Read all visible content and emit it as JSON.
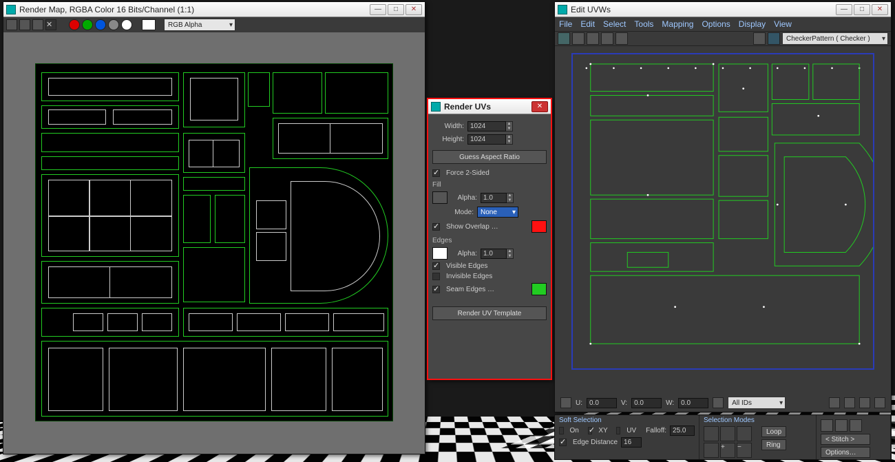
{
  "render_map": {
    "title": "Render Map, RGBA Color 16 Bits/Channel (1:1)",
    "channel_dropdown": "RGB Alpha"
  },
  "render_uvs": {
    "title": "Render UVs",
    "width_label": "Width:",
    "width_value": "1024",
    "height_label": "Height:",
    "height_value": "1024",
    "guess_btn": "Guess Aspect Ratio",
    "force2sided_label": "Force 2-Sided",
    "fill_label": "Fill",
    "alpha_label_fill": "Alpha:",
    "alpha_value_fill": "1.0",
    "mode_label": "Mode:",
    "mode_value": "None",
    "show_overlap_label": "Show Overlap …",
    "overlap_color": "#f11111",
    "edges_label": "Edges",
    "alpha_label_edges": "Alpha:",
    "alpha_value_edges": "1.0",
    "visible_edges": "Visible Edges",
    "invisible_edges": "Invisible Edges",
    "seam_edges": "Seam Edges …",
    "seam_color": "#22cc22",
    "render_btn": "Render UV Template"
  },
  "edit_uvws": {
    "title": "Edit UVWs",
    "menu": [
      "File",
      "Edit",
      "Select",
      "Tools",
      "Mapping",
      "Options",
      "Display",
      "View"
    ],
    "texmap_dropdown": "CheckerPattern  ( Checker )",
    "u_label": "U:",
    "u_val": "0.0",
    "v_label": "V:",
    "v_val": "0.0",
    "w_label": "W:",
    "w_val": "0.0",
    "ids_dropdown": "All IDs"
  },
  "bottom_panel": {
    "soft_selection_title": "Soft Selection",
    "on_label": "On",
    "xy_label": "XY",
    "uv_label": "UV",
    "falloff_label": "Falloff:",
    "falloff_value": "25.0",
    "edge_distance_label": "Edge Distance",
    "edge_distance_value": "16",
    "selection_modes_title": "Selection Modes",
    "loop_btn": "Loop",
    "ring_btn": "Ring",
    "stitch_btn": "< Stitch >",
    "options_btn": "Options…"
  }
}
